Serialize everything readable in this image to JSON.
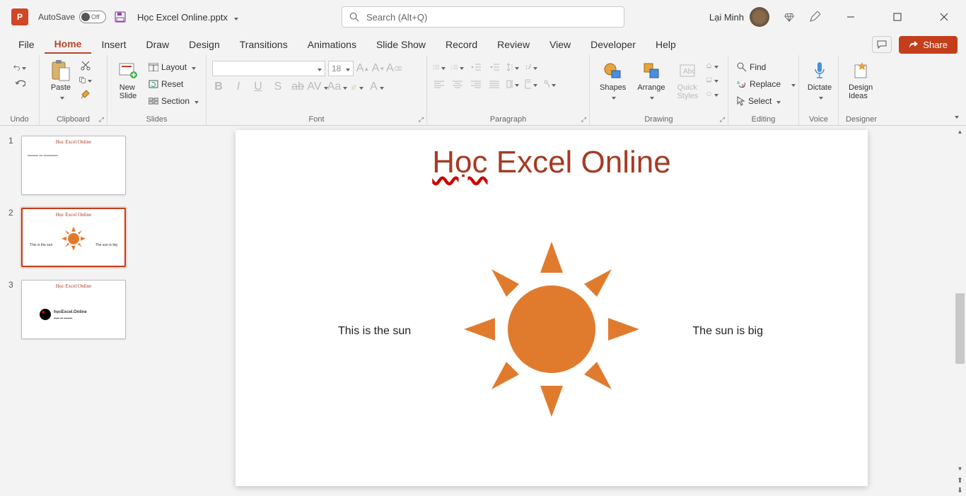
{
  "title_bar": {
    "app_letter": "P",
    "autosave_label": "AutoSave",
    "autosave_state": "Off",
    "filename": "Học Excel Online.pptx",
    "search_placeholder": "Search (Alt+Q)",
    "user_name": "Lại Minh"
  },
  "menu": {
    "tabs": [
      "File",
      "Home",
      "Insert",
      "Draw",
      "Design",
      "Transitions",
      "Animations",
      "Slide Show",
      "Record",
      "Review",
      "View",
      "Developer",
      "Help"
    ],
    "active": "Home",
    "share_label": "Share"
  },
  "ribbon": {
    "groups": {
      "undo": "Undo",
      "clipboard": "Clipboard",
      "slides": "Slides",
      "font": "Font",
      "paragraph": "Paragraph",
      "drawing": "Drawing",
      "editing": "Editing",
      "voice": "Voice",
      "designer": "Designer"
    },
    "paste": "Paste",
    "new_slide": "New\nSlide",
    "layout": "Layout",
    "reset": "Reset",
    "section": "Section",
    "font_size": "18",
    "shapes": "Shapes",
    "arrange": "Arrange",
    "quick_styles": "Quick\nStyles",
    "find": "Find",
    "replace": "Replace",
    "select": "Select",
    "dictate": "Dictate",
    "design_ideas": "Design\nIdeas"
  },
  "thumbs": [
    {
      "num": "1",
      "title": "Học Excel Online",
      "subtitle": ""
    },
    {
      "num": "2",
      "title": "Học Excel Online",
      "left": "This is the sun",
      "right": "The sun is big"
    },
    {
      "num": "3",
      "title": "Học Excel Online",
      "logo_text": "họcExcel.Online",
      "logo_sub": ""
    }
  ],
  "slide": {
    "title_part1": "Học",
    "title_part2": " Excel Online",
    "text_left": "This is the sun",
    "text_right": "The sun is big"
  }
}
